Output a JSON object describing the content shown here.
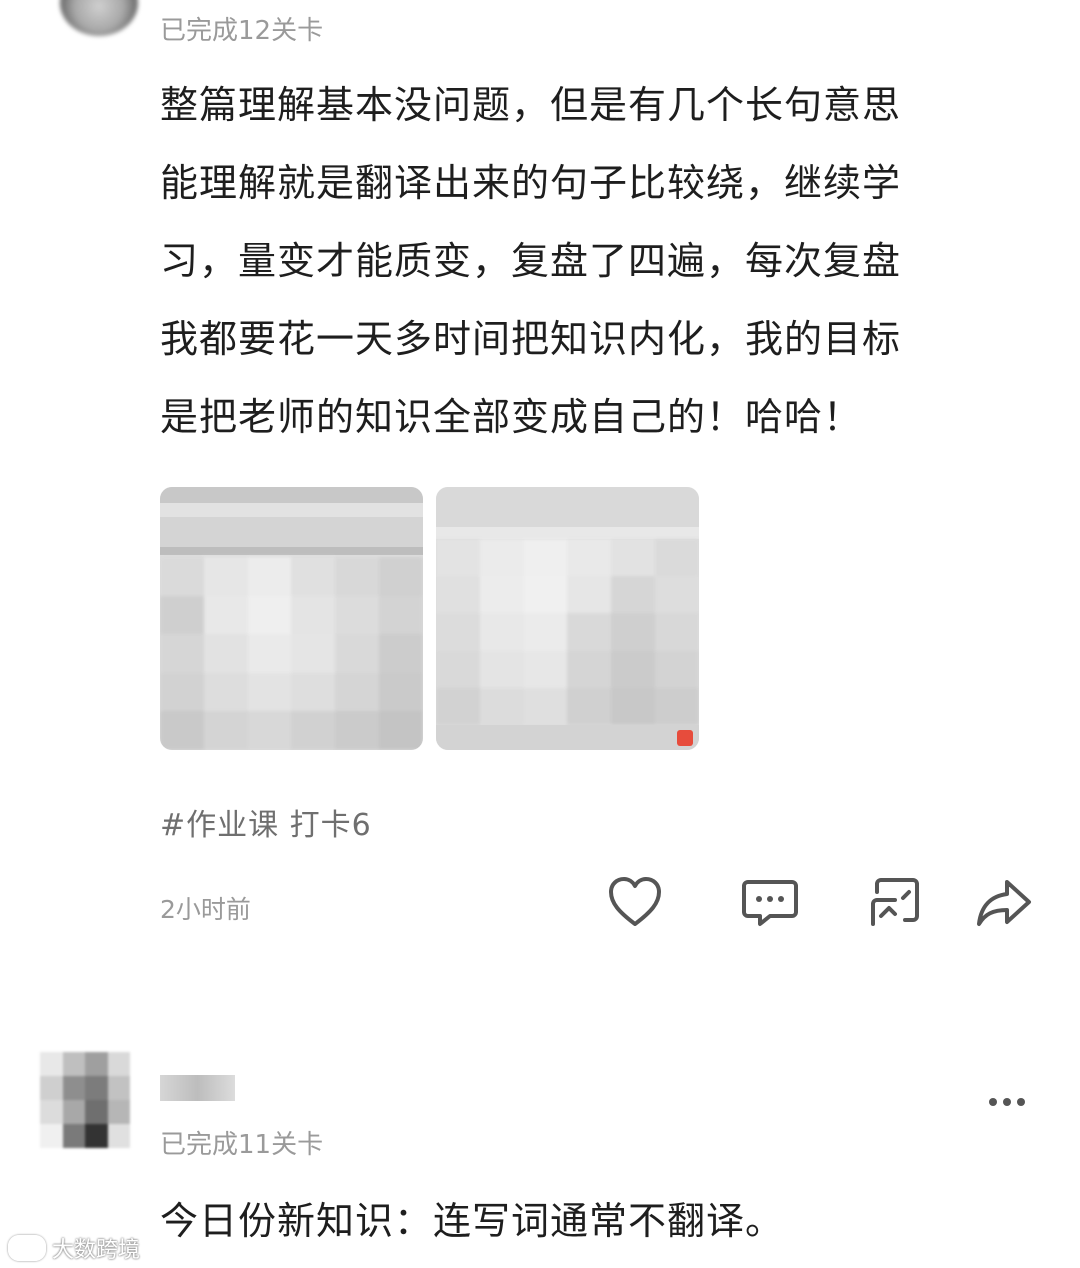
{
  "post1": {
    "status": "已完成12关卡",
    "body_lines": [
      "整篇理解基本没问题，但是有几个长句意思",
      "能理解就是翻译出来的句子比较绕，继续学",
      "习，量变才能质变，复盘了四遍，每次复盘",
      "我都要花一天多时间把知识内化，我的目标",
      "是把老师的知识全部变成自己的！哈哈！"
    ],
    "hashtag": "#作业课 打卡6",
    "time": "2小时前",
    "actions": [
      "heart-icon",
      "comment-icon",
      "repost-icon",
      "share-icon"
    ]
  },
  "post2": {
    "status": "已完成11关卡",
    "body": "今日份新知识：连写词通常不翻译。"
  },
  "watermark": {
    "text": "大数跨境"
  },
  "colors": {
    "text": "#1e1e1e",
    "muted": "#9a9a9a",
    "hashtag": "#6f6f6f",
    "icon": "#555555"
  }
}
